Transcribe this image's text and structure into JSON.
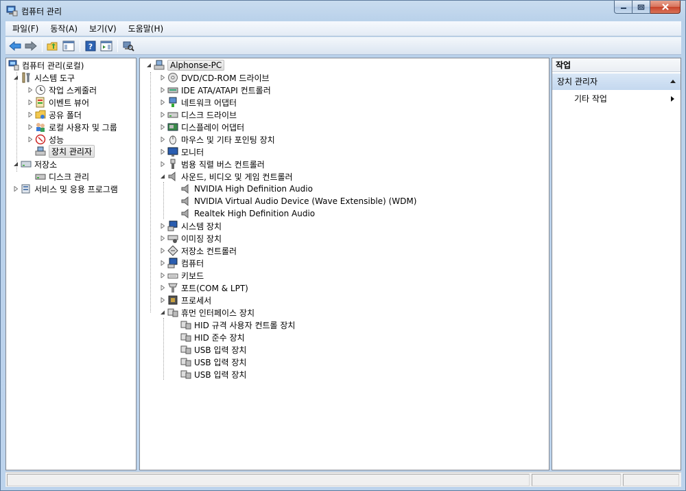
{
  "window": {
    "title": "컴퓨터 관리"
  },
  "menu": [
    {
      "label": "파일(F)",
      "name": "menu-file"
    },
    {
      "label": "동작(A)",
      "name": "menu-action"
    },
    {
      "label": "보기(V)",
      "name": "menu-view"
    },
    {
      "label": "도움말(H)",
      "name": "menu-help"
    }
  ],
  "toolbar": {
    "buttons": [
      "back-icon",
      "forward-icon",
      "up-folder-icon",
      "show-hide-console-tree-icon",
      "help-icon",
      "show-hide-action-pane-icon",
      "scan-hardware-icon"
    ]
  },
  "left_tree": {
    "root": "컴퓨터 관리(로컬)",
    "system_tools": "시스템 도구",
    "task_scheduler": "작업 스케줄러",
    "event_viewer": "이벤트 뷰어",
    "shared_folders": "공유 폴더",
    "local_users": "로컬 사용자 및 그룹",
    "performance": "성능",
    "device_manager": "장치 관리자",
    "storage": "저장소",
    "disk_management": "디스크 관리",
    "services_apps": "서비스 및 응용 프로그램"
  },
  "device_tree": {
    "computer_name": "Alphonse-PC",
    "categories": [
      {
        "label": "DVD/CD-ROM 드라이브",
        "icon": "dvd-drive-icon"
      },
      {
        "label": "IDE ATA/ATAPI 컨트롤러",
        "icon": "ide-controller-icon"
      },
      {
        "label": "네트워크 어댑터",
        "icon": "network-adapter-icon"
      },
      {
        "label": "디스크 드라이브",
        "icon": "disk-drive-icon"
      },
      {
        "label": "디스플레이 어댑터",
        "icon": "display-adapter-icon"
      },
      {
        "label": "마우스 및 기타 포인팅 장치",
        "icon": "mouse-icon"
      },
      {
        "label": "모니터",
        "icon": "monitor-icon"
      },
      {
        "label": "범용 직렬 버스 컨트롤러",
        "icon": "usb-controller-icon"
      }
    ],
    "sound_category": "사운드, 비디오 및 게임 컨트롤러",
    "sound_devices": [
      "NVIDIA High Definition Audio",
      "NVIDIA Virtual Audio Device (Wave Extensible) (WDM)",
      "Realtek High Definition Audio"
    ],
    "more_categories": [
      {
        "label": "시스템 장치",
        "icon": "system-device-icon"
      },
      {
        "label": "이미징 장치",
        "icon": "imaging-device-icon"
      },
      {
        "label": "저장소 컨트롤러",
        "icon": "storage-controller-icon"
      },
      {
        "label": "컴퓨터",
        "icon": "computer-icon"
      },
      {
        "label": "키보드",
        "icon": "keyboard-icon"
      },
      {
        "label": "포트(COM & LPT)",
        "icon": "port-icon"
      },
      {
        "label": "프로세서",
        "icon": "processor-icon"
      }
    ],
    "hid_category": "휴먼 인터페이스 장치",
    "hid_devices": [
      "HID 규격 사용자 컨트롤 장치",
      "HID 준수 장치",
      "USB 입력 장치",
      "USB 입력 장치",
      "USB 입력 장치"
    ]
  },
  "actions": {
    "header": "작업",
    "section": "장치 관리자",
    "more": "기타 작업"
  }
}
